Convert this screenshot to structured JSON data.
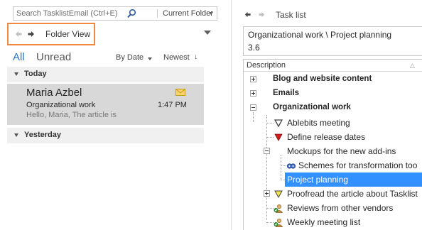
{
  "search": {
    "placeholder": "Search TasklistEmail (Ctrl+E)",
    "scope": "Current Folder"
  },
  "left_nav": {
    "folder_view_label": "Folder View"
  },
  "filters": {
    "all": "All",
    "unread": "Unread",
    "sort_by": "By Date",
    "order": "Newest",
    "order_arrow": "↓"
  },
  "groups": {
    "today": "Today",
    "yesterday": "Yesterday"
  },
  "message": {
    "sender": "Maria Azbel",
    "subject": "Organizational work",
    "preview": "Hello, Maria,  The article is",
    "time": "1:47 PM"
  },
  "task_pane": {
    "title": "Task list",
    "path": "Organizational work \\ Project planning",
    "number": "3.6",
    "column_header": "Description",
    "sort_glyph": "△",
    "items": [
      {
        "label": "Blog and website content",
        "bold": true
      },
      {
        "label": "Emails",
        "bold": true
      },
      {
        "label": "Organizational work",
        "bold": true
      },
      {
        "label": "Ablebits meeting",
        "icon": "flag-outline"
      },
      {
        "label": "Define release dates",
        "icon": "flag-red"
      },
      {
        "label": "Mockups for the new add-ins"
      },
      {
        "label": "Schemes for transformation too",
        "icon": "linked-items"
      },
      {
        "label": "Project planning",
        "selected": true
      },
      {
        "label": "Proofread the article about Tasklist",
        "icon": "flag-yellow"
      },
      {
        "label": "Reviews from other vendors",
        "icon": "assigned-task"
      },
      {
        "label": "Weekly meeting list",
        "icon": "assigned-task"
      }
    ]
  },
  "colors": {
    "accent": "#2a72c3",
    "highlight_border": "#f0883e",
    "selection": "#3390ff",
    "selected_mail": "#d8d8d8"
  }
}
